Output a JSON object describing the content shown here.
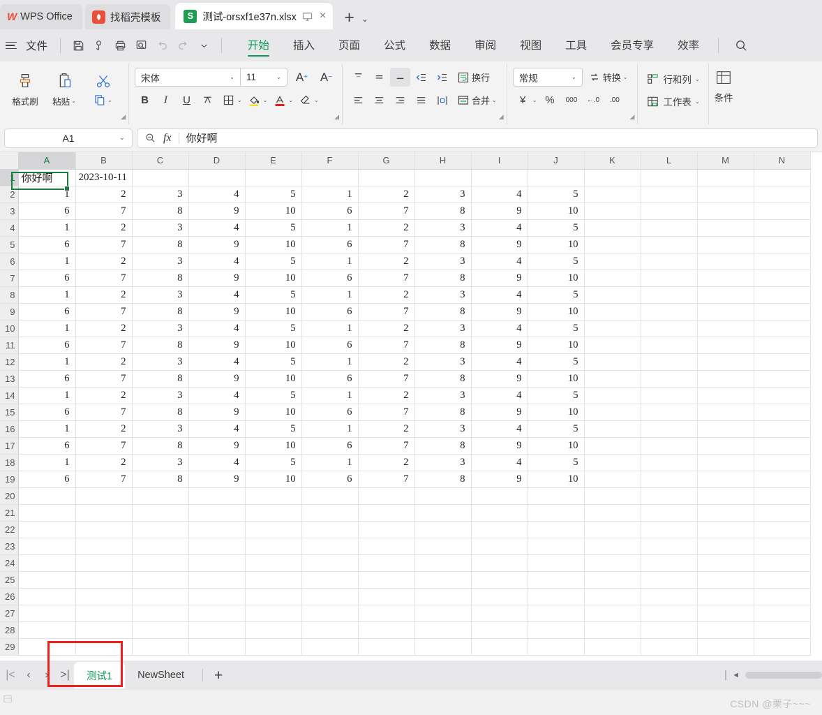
{
  "titlebar": {
    "app_tab": "WPS Office",
    "template_tab": "找稻壳模板",
    "doc_tab": "测试-orsxf1e37n.xlsx",
    "doc_icon_letter": "S",
    "new_tab_label": "+",
    "tab_dropdown_label": "⌄",
    "monitor_icon": "monitor-icon",
    "close_icon": "×"
  },
  "menubar": {
    "file": "文件",
    "quick": [
      {
        "name": "save-icon",
        "label": "保存"
      },
      {
        "name": "cloud-sync-icon",
        "label": "同步"
      },
      {
        "name": "print-icon",
        "label": "打印"
      },
      {
        "name": "print-preview-icon",
        "label": "打印预览"
      },
      {
        "name": "undo-icon",
        "label": "撤销"
      },
      {
        "name": "redo-icon",
        "label": "恢复"
      },
      {
        "name": "chevron-down-icon",
        "label": "更多"
      }
    ],
    "tabs": [
      {
        "label": "开始",
        "active": true
      },
      {
        "label": "插入",
        "active": false
      },
      {
        "label": "页面",
        "active": false
      },
      {
        "label": "公式",
        "active": false
      },
      {
        "label": "数据",
        "active": false
      },
      {
        "label": "审阅",
        "active": false
      },
      {
        "label": "视图",
        "active": false
      },
      {
        "label": "工具",
        "active": false
      },
      {
        "label": "会员专享",
        "active": false
      },
      {
        "label": "效率",
        "active": false
      }
    ],
    "search_icon": "search-icon"
  },
  "ribbon": {
    "clipboard": {
      "format_painter": "格式刷",
      "paste": "粘贴",
      "copy": "复制"
    },
    "font": {
      "family": "宋体",
      "size": "11",
      "grow": "A⁺",
      "shrink": "A⁻",
      "bold": "B",
      "italic": "I",
      "underline": "U",
      "strikethrough": "A",
      "borders": "田",
      "fill_color": "填充颜色",
      "font_color": "字体颜色",
      "clear_format": "清除格式"
    },
    "align": {
      "top": "顶端对齐",
      "middle": "垂直居中",
      "bottom": "底端对齐",
      "decrease_indent": "减少缩进",
      "increase_indent": "增加缩进",
      "wrap": "换行",
      "align_left": "左对齐",
      "align_center": "居中",
      "align_right": "右对齐",
      "justify": "两端对齐",
      "orientation": "文字方向",
      "merge": "合并"
    },
    "number": {
      "format": "常规",
      "convert": "转换",
      "currency": "¥",
      "percent": "%",
      "comma": "000",
      "decrease_decimal": "←.0",
      "increase_decimal": ".00"
    },
    "cells": {
      "rows_cols": "行和列",
      "worksheet": "工作表"
    },
    "styles": {
      "conditional": "条件"
    }
  },
  "formulabar": {
    "name_box": "A1",
    "name_box_chevron": "⌄",
    "zoom_icon": "zoom-out-icon",
    "fx_label": "fx",
    "content": "你好啊"
  },
  "grid": {
    "columns": [
      "A",
      "B",
      "C",
      "D",
      "E",
      "F",
      "G",
      "H",
      "I",
      "J",
      "K",
      "L",
      "M",
      "N"
    ],
    "selected_column": "A",
    "selected_row": 1,
    "active_cell": "A1",
    "rows": [
      {
        "num": 1,
        "cells": [
          "你好啊",
          "2023-10-11",
          "",
          "",
          "",
          "",
          "",
          "",
          "",
          "",
          "",
          "",
          "",
          ""
        ],
        "type": "text"
      },
      {
        "num": 2,
        "cells": [
          "1",
          "2",
          "3",
          "4",
          "5",
          "1",
          "2",
          "3",
          "4",
          "5",
          "",
          "",
          "",
          ""
        ],
        "type": "num"
      },
      {
        "num": 3,
        "cells": [
          "6",
          "7",
          "8",
          "9",
          "10",
          "6",
          "7",
          "8",
          "9",
          "10",
          "",
          "",
          "",
          ""
        ],
        "type": "num"
      },
      {
        "num": 4,
        "cells": [
          "1",
          "2",
          "3",
          "4",
          "5",
          "1",
          "2",
          "3",
          "4",
          "5",
          "",
          "",
          "",
          ""
        ],
        "type": "num"
      },
      {
        "num": 5,
        "cells": [
          "6",
          "7",
          "8",
          "9",
          "10",
          "6",
          "7",
          "8",
          "9",
          "10",
          "",
          "",
          "",
          ""
        ],
        "type": "num"
      },
      {
        "num": 6,
        "cells": [
          "1",
          "2",
          "3",
          "4",
          "5",
          "1",
          "2",
          "3",
          "4",
          "5",
          "",
          "",
          "",
          ""
        ],
        "type": "num"
      },
      {
        "num": 7,
        "cells": [
          "6",
          "7",
          "8",
          "9",
          "10",
          "6",
          "7",
          "8",
          "9",
          "10",
          "",
          "",
          "",
          ""
        ],
        "type": "num"
      },
      {
        "num": 8,
        "cells": [
          "1",
          "2",
          "3",
          "4",
          "5",
          "1",
          "2",
          "3",
          "4",
          "5",
          "",
          "",
          "",
          ""
        ],
        "type": "num"
      },
      {
        "num": 9,
        "cells": [
          "6",
          "7",
          "8",
          "9",
          "10",
          "6",
          "7",
          "8",
          "9",
          "10",
          "",
          "",
          "",
          ""
        ],
        "type": "num"
      },
      {
        "num": 10,
        "cells": [
          "1",
          "2",
          "3",
          "4",
          "5",
          "1",
          "2",
          "3",
          "4",
          "5",
          "",
          "",
          "",
          ""
        ],
        "type": "num"
      },
      {
        "num": 11,
        "cells": [
          "6",
          "7",
          "8",
          "9",
          "10",
          "6",
          "7",
          "8",
          "9",
          "10",
          "",
          "",
          "",
          ""
        ],
        "type": "num"
      },
      {
        "num": 12,
        "cells": [
          "1",
          "2",
          "3",
          "4",
          "5",
          "1",
          "2",
          "3",
          "4",
          "5",
          "",
          "",
          "",
          ""
        ],
        "type": "num"
      },
      {
        "num": 13,
        "cells": [
          "6",
          "7",
          "8",
          "9",
          "10",
          "6",
          "7",
          "8",
          "9",
          "10",
          "",
          "",
          "",
          ""
        ],
        "type": "num"
      },
      {
        "num": 14,
        "cells": [
          "1",
          "2",
          "3",
          "4",
          "5",
          "1",
          "2",
          "3",
          "4",
          "5",
          "",
          "",
          "",
          ""
        ],
        "type": "num"
      },
      {
        "num": 15,
        "cells": [
          "6",
          "7",
          "8",
          "9",
          "10",
          "6",
          "7",
          "8",
          "9",
          "10",
          "",
          "",
          "",
          ""
        ],
        "type": "num"
      },
      {
        "num": 16,
        "cells": [
          "1",
          "2",
          "3",
          "4",
          "5",
          "1",
          "2",
          "3",
          "4",
          "5",
          "",
          "",
          "",
          ""
        ],
        "type": "num"
      },
      {
        "num": 17,
        "cells": [
          "6",
          "7",
          "8",
          "9",
          "10",
          "6",
          "7",
          "8",
          "9",
          "10",
          "",
          "",
          "",
          ""
        ],
        "type": "num"
      },
      {
        "num": 18,
        "cells": [
          "1",
          "2",
          "3",
          "4",
          "5",
          "1",
          "2",
          "3",
          "4",
          "5",
          "",
          "",
          "",
          ""
        ],
        "type": "num"
      },
      {
        "num": 19,
        "cells": [
          "6",
          "7",
          "8",
          "9",
          "10",
          "6",
          "7",
          "8",
          "9",
          "10",
          "",
          "",
          "",
          ""
        ],
        "type": "num"
      },
      {
        "num": 20,
        "cells": [
          "",
          "",
          "",
          "",
          "",
          "",
          "",
          "",
          "",
          "",
          "",
          "",
          "",
          ""
        ],
        "type": "num"
      },
      {
        "num": 21,
        "cells": [
          "",
          "",
          "",
          "",
          "",
          "",
          "",
          "",
          "",
          "",
          "",
          "",
          "",
          ""
        ],
        "type": "num"
      },
      {
        "num": 22,
        "cells": [
          "",
          "",
          "",
          "",
          "",
          "",
          "",
          "",
          "",
          "",
          "",
          "",
          "",
          ""
        ],
        "type": "num"
      },
      {
        "num": 23,
        "cells": [
          "",
          "",
          "",
          "",
          "",
          "",
          "",
          "",
          "",
          "",
          "",
          "",
          "",
          ""
        ],
        "type": "num"
      },
      {
        "num": 24,
        "cells": [
          "",
          "",
          "",
          "",
          "",
          "",
          "",
          "",
          "",
          "",
          "",
          "",
          "",
          ""
        ],
        "type": "num"
      },
      {
        "num": 25,
        "cells": [
          "",
          "",
          "",
          "",
          "",
          "",
          "",
          "",
          "",
          "",
          "",
          "",
          "",
          ""
        ],
        "type": "num"
      },
      {
        "num": 26,
        "cells": [
          "",
          "",
          "",
          "",
          "",
          "",
          "",
          "",
          "",
          "",
          "",
          "",
          "",
          ""
        ],
        "type": "num"
      },
      {
        "num": 27,
        "cells": [
          "",
          "",
          "",
          "",
          "",
          "",
          "",
          "",
          "",
          "",
          "",
          "",
          "",
          ""
        ],
        "type": "num"
      },
      {
        "num": 28,
        "cells": [
          "",
          "",
          "",
          "",
          "",
          "",
          "",
          "",
          "",
          "",
          "",
          "",
          "",
          ""
        ],
        "type": "num"
      },
      {
        "num": 29,
        "cells": [
          "",
          "",
          "",
          "",
          "",
          "",
          "",
          "",
          "",
          "",
          "",
          "",
          "",
          ""
        ],
        "type": "num"
      }
    ]
  },
  "sheetbar": {
    "nav_first": "|<",
    "nav_prev": "‹",
    "nav_next": "›",
    "nav_last": ">|",
    "tabs": [
      {
        "label": "测试1",
        "active": true
      },
      {
        "label": "NewSheet",
        "active": false
      }
    ],
    "add_sheet": "+",
    "scroll_left_arrow": "◄"
  },
  "statusbar": {
    "watermark": "CSDN @栗子~~~"
  },
  "colors": {
    "accent_green": "#0e9a57",
    "selection_green": "#1a7c3e",
    "annotation_red": "#ef1f1f",
    "chrome_gray": "#e8e8ea",
    "ribbon_gray": "#f3f3f4"
  }
}
